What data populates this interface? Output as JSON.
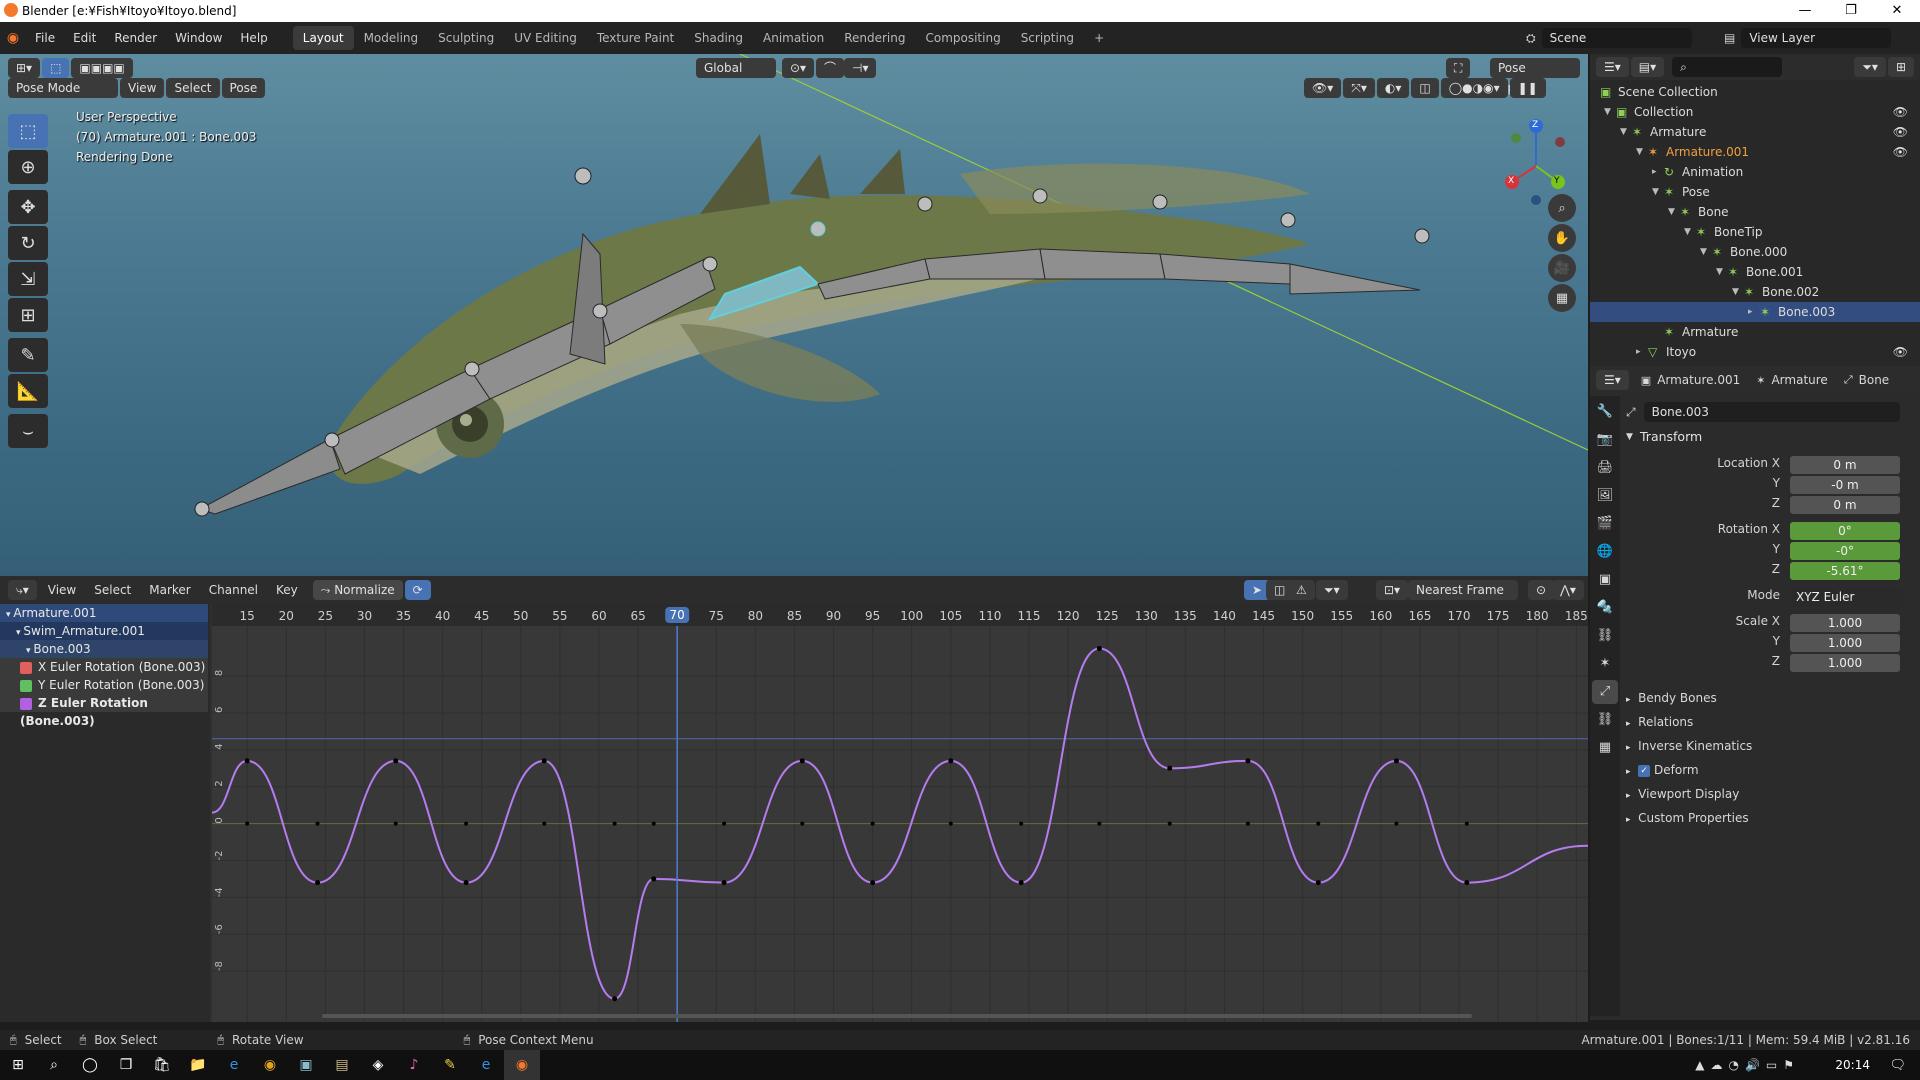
{
  "window": {
    "title": "Blender [e:¥Fish¥Itoyo¥Itoyo.blend]",
    "controls": [
      "—",
      "❐",
      "✕"
    ]
  },
  "topbar": {
    "menus": [
      "File",
      "Edit",
      "Render",
      "Window",
      "Help"
    ],
    "workspaces": [
      "Layout",
      "Modeling",
      "Sculpting",
      "UV Editing",
      "Texture Paint",
      "Shading",
      "Animation",
      "Rendering",
      "Compositing",
      "Scripting"
    ],
    "active_workspace": "Layout",
    "add_tab": "+",
    "scene": "Scene",
    "view_layer": "View Layer"
  },
  "viewport": {
    "mode": "Pose Mode",
    "menus": [
      "View",
      "Select",
      "Pose"
    ],
    "orientation": "Global",
    "pose_options": "Pose Options",
    "info_lines": [
      "User Perspective",
      "(70) Armature.001 : Bone.003",
      "Rendering Done"
    ],
    "gizmo_axes": {
      "z": "Z",
      "x": "X",
      "y": "Y"
    },
    "colors": {
      "bone": "#8c8c8c",
      "active_bone": "#5fd0e0",
      "y_axis_line": "#9ccd3a"
    }
  },
  "outliner": {
    "search_placeholder": "",
    "rows": [
      {
        "label": "Scene Collection",
        "depth": 0,
        "tri": "",
        "icon": "▣",
        "eye": ""
      },
      {
        "label": "Collection",
        "depth": 1,
        "tri": "▼",
        "icon": "▣",
        "eye": "👁"
      },
      {
        "label": "Armature",
        "depth": 2,
        "tri": "▼",
        "icon": "✶",
        "eye": "👁"
      },
      {
        "label": "Armature.001",
        "depth": 3,
        "tri": "▼",
        "icon": "✶",
        "eye": "👁",
        "orange": true
      },
      {
        "label": "Animation",
        "depth": 4,
        "tri": "▸",
        "icon": "↻",
        "eye": ""
      },
      {
        "label": "Pose",
        "depth": 4,
        "tri": "▼",
        "icon": "✶",
        "eye": ""
      },
      {
        "label": "Bone",
        "depth": 5,
        "tri": "▼",
        "icon": "✶",
        "eye": ""
      },
      {
        "label": "BoneTip",
        "depth": 6,
        "tri": "▼",
        "icon": "✶",
        "eye": ""
      },
      {
        "label": "Bone.000",
        "depth": 7,
        "tri": "▼",
        "icon": "✶",
        "eye": ""
      },
      {
        "label": "Bone.001",
        "depth": 8,
        "tri": "▼",
        "icon": "✶",
        "eye": ""
      },
      {
        "label": "Bone.002",
        "depth": 9,
        "tri": "▼",
        "icon": "✶",
        "eye": ""
      },
      {
        "label": "Bone.003",
        "depth": 10,
        "tri": "▸",
        "icon": "✶",
        "eye": "",
        "selected": true
      },
      {
        "label": "Armature",
        "depth": 4,
        "tri": "",
        "icon": "✶",
        "eye": ""
      },
      {
        "label": "Itoyo",
        "depth": 3,
        "tri": "▸",
        "icon": "▽",
        "eye": "👁"
      }
    ]
  },
  "properties": {
    "breadcrumb": [
      "Armature.001",
      "Armature",
      "Bone"
    ],
    "bone_name": "Bone.003",
    "transform_header": "Transform",
    "location": [
      {
        "label": "Location X",
        "value": "0 m"
      },
      {
        "label": "Y",
        "value": "-0 m"
      },
      {
        "label": "Z",
        "value": "0 m"
      }
    ],
    "rotation": [
      {
        "label": "Rotation X",
        "value": "0°"
      },
      {
        "label": "Y",
        "value": "-0°"
      },
      {
        "label": "Z",
        "value": "-5.61°"
      }
    ],
    "mode_label": "Mode",
    "mode_value": "XYZ Euler",
    "scale": [
      {
        "label": "Scale X",
        "value": "1.000"
      },
      {
        "label": "Y",
        "value": "1.000"
      },
      {
        "label": "Z",
        "value": "1.000"
      }
    ],
    "panels": [
      "Bendy Bones",
      "Relations",
      "Inverse Kinematics",
      "Deform",
      "Viewport Display",
      "Custom Properties"
    ]
  },
  "graph_editor": {
    "menus": [
      "View",
      "Select",
      "Marker",
      "Channel",
      "Key"
    ],
    "normalize": "Normalize",
    "snap": "Nearest Frame",
    "current_frame": 70,
    "frame_ticks": [
      15,
      20,
      25,
      30,
      35,
      40,
      45,
      50,
      55,
      60,
      65,
      70,
      75,
      80,
      85,
      90,
      95,
      100,
      105,
      110,
      115,
      120,
      125,
      130,
      135,
      140,
      145,
      150,
      155,
      160,
      165,
      170,
      175,
      180,
      185
    ],
    "value_ticks": [
      "8",
      "6",
      "4",
      "2",
      "0",
      "-2",
      "-4",
      "-6",
      "-8"
    ],
    "channels": [
      {
        "label": "Armature.001"
      },
      {
        "label": "Swim_Armature.001"
      },
      {
        "label": "Bone.003"
      },
      {
        "label": "X Euler Rotation (Bone.003)"
      },
      {
        "label": "Y Euler Rotation (Bone.003)"
      },
      {
        "label": "Z Euler Rotation (Bone.003)"
      }
    ],
    "curve_color": "#b57cf0",
    "keyframes_z": [
      [
        15,
        3.4
      ],
      [
        24,
        -3.2
      ],
      [
        34,
        3.4
      ],
      [
        43,
        -3.2
      ],
      [
        53,
        3.4
      ],
      [
        62,
        -9.5
      ],
      [
        67,
        -3.0
      ],
      [
        76,
        -3.2
      ],
      [
        86,
        3.4
      ],
      [
        95,
        -3.2
      ],
      [
        105,
        3.4
      ],
      [
        114,
        -3.2
      ],
      [
        124,
        9.5
      ],
      [
        133,
        3.0
      ],
      [
        143,
        3.4
      ],
      [
        152,
        -3.2
      ],
      [
        162,
        3.4
      ],
      [
        171,
        -3.2
      ]
    ]
  },
  "statusbar": {
    "items": [
      "Select",
      "Box Select",
      "Rotate View",
      "Pose Context Menu"
    ],
    "info": "Armature.001 | Bones:1/11 | Mem: 59.4 MiB | v2.81.16"
  },
  "taskbar": {
    "clock": "20:14"
  }
}
